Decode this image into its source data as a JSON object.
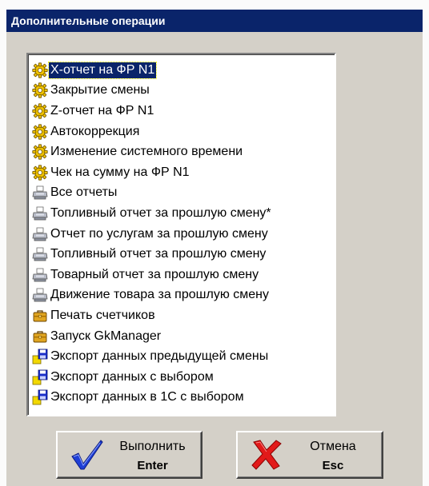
{
  "window": {
    "title": "Дополнительные операции"
  },
  "operations": [
    {
      "label": "X-отчет на ФР N1",
      "icon": "gear-icon",
      "selected": true
    },
    {
      "label": "Закрытие смены",
      "icon": "gear-icon"
    },
    {
      "label": "Z-отчет на ФР N1",
      "icon": "gear-icon"
    },
    {
      "label": "Автокоррекция",
      "icon": "gear-icon"
    },
    {
      "label": "Изменение системного времени",
      "icon": "gear-icon"
    },
    {
      "label": "Чек на сумму на ФР N1",
      "icon": "gear-icon"
    },
    {
      "label": "Все отчеты",
      "icon": "printer-icon"
    },
    {
      "label": "Топливный отчет за прошлую смену*",
      "icon": "printer-icon"
    },
    {
      "label": "Отчет по услугам за прошлую смену",
      "icon": "printer-icon"
    },
    {
      "label": "Топливный отчет за прошлую смену",
      "icon": "printer-icon"
    },
    {
      "label": "Товарный отчет за прошлую смену",
      "icon": "printer-icon"
    },
    {
      "label": "Движение товара за прошлую смену",
      "icon": "printer-icon"
    },
    {
      "label": "Печать счетчиков",
      "icon": "briefcase-icon"
    },
    {
      "label": "Запуск GkManager",
      "icon": "briefcase-icon"
    },
    {
      "label": "Экспорт данных предыдущей смены",
      "icon": "floppy-export-icon"
    },
    {
      "label": "Экспорт данных с выбором",
      "icon": "floppy-export-icon"
    },
    {
      "label": "Экспорт данных в 1С с выбором",
      "icon": "floppy-export-icon"
    }
  ],
  "buttons": {
    "execute": {
      "label": "Выполнить",
      "hotkey": "Enter",
      "icon": "checkmark-icon"
    },
    "cancel": {
      "label": "Отмена",
      "hotkey": "Esc",
      "icon": "red-cross-icon"
    }
  },
  "colors": {
    "titlebar": "#0a246a",
    "dialog_face": "#d4d0c8",
    "selection": "#0a246a"
  }
}
